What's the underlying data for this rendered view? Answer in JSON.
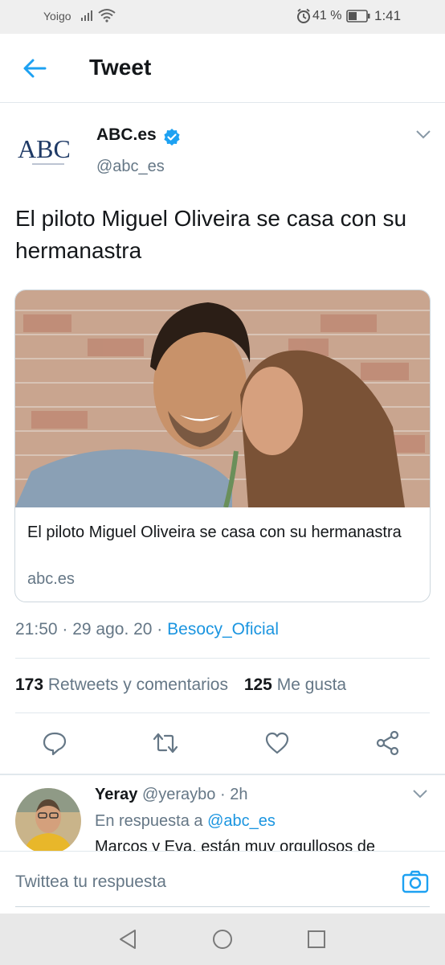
{
  "status_bar": {
    "carrier": "Yoigo",
    "battery_percent": "41 %",
    "time": "1:41",
    "icons": [
      "signal-icon",
      "wifi-icon",
      "alarm-icon",
      "battery-icon"
    ]
  },
  "header": {
    "title": "Tweet",
    "back_icon": "back-arrow-icon"
  },
  "tweet": {
    "author_name": "ABC.es",
    "author_handle": "@abc_es",
    "avatar_text": "ABC",
    "text": "El piloto Miguel Oliveira se casa con su hermanastra",
    "card": {
      "title": "El piloto Miguel Oliveira se casa con su hermanastra",
      "domain": "abc.es"
    },
    "meta": {
      "time_date": "21:50 · 29 ago. 20 · ",
      "source": "Besocy_Oficial"
    },
    "stats": {
      "retweets_count": "173",
      "retweets_label": "Retweets y comentarios",
      "likes_count": "125",
      "likes_label": "Me gusta"
    },
    "actions": [
      "reply-icon",
      "retweet-icon",
      "like-icon",
      "share-icon"
    ]
  },
  "reply": {
    "name": "Yeray",
    "handle": "@yeraybo",
    "time": "· 2h",
    "context_prefix": "En respuesta a",
    "context_mention": "@abc_es",
    "text": "Marcos y Eva, están muy orgullosos de"
  },
  "compose": {
    "placeholder": "Twittea tu respuesta"
  },
  "colors": {
    "accent": "#1b95e0",
    "secondary_text": "#657786",
    "primary_text": "#14171a",
    "divider": "#e1e8ed"
  }
}
